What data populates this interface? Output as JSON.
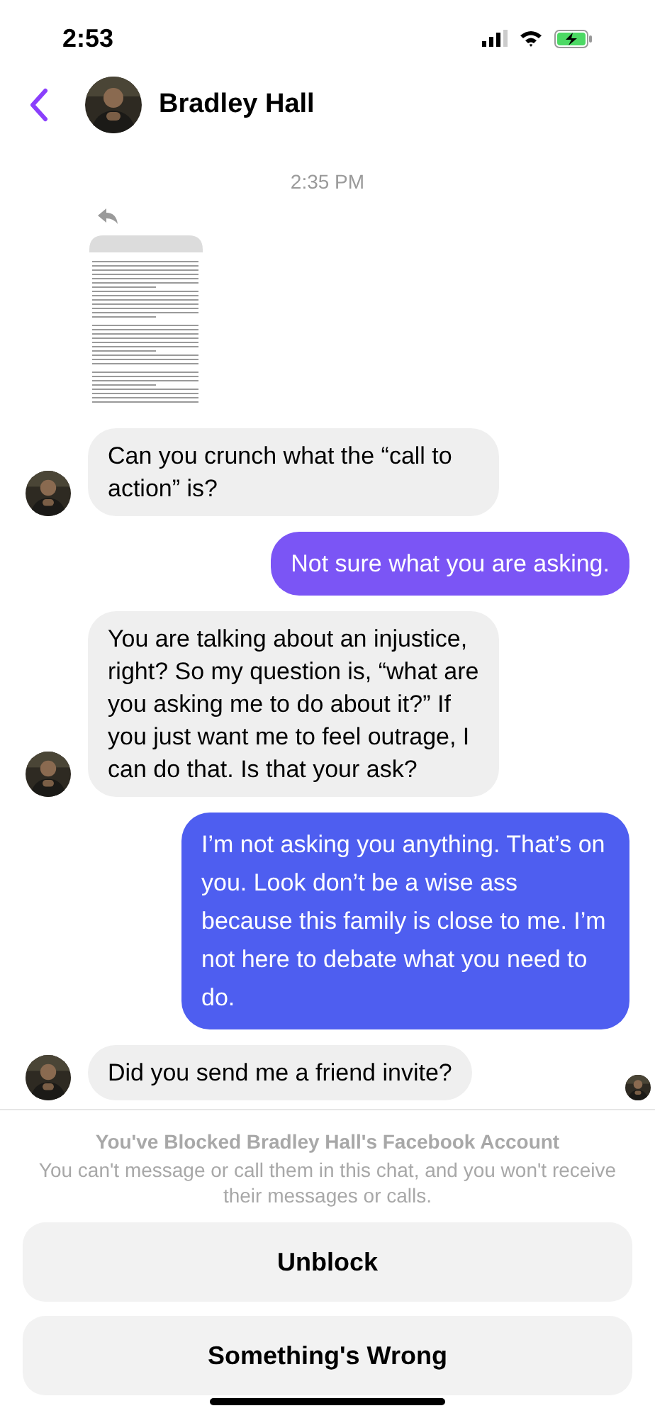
{
  "status_bar": {
    "time": "2:53"
  },
  "header": {
    "name": "Bradley Hall"
  },
  "timestamp": "2:35 PM",
  "messages": [
    {
      "kind": "attachment"
    },
    {
      "kind": "incoming",
      "text": "Can you crunch what the “call to action” is?",
      "avatar": true,
      "seen": false
    },
    {
      "kind": "outgoing",
      "text": "Not sure what you are asking.",
      "color": "#7b55f5"
    },
    {
      "kind": "incoming",
      "text": "You are talking about an injustice, right?  So my question is, “what are you asking me to do about it?”  If you just want me to feel outrage, I can do that.  Is that your ask?",
      "avatar": true,
      "seen": false
    },
    {
      "kind": "outgoing",
      "text": "I’m not asking you anything. That’s on you. Look don’t be a wise ass because this family is close to me. I’m not here to debate what you need to do.",
      "color": "#4e5ef0"
    },
    {
      "kind": "incoming",
      "text": "Did you send me a friend invite?",
      "avatar": true,
      "seen": true
    }
  ],
  "blocked": {
    "title": "You've Blocked Bradley Hall's Facebook Account",
    "body": "You can't message or call them in this chat, and you won't receive their messages or calls."
  },
  "buttons": [
    "Unblock",
    "Something's Wrong"
  ]
}
